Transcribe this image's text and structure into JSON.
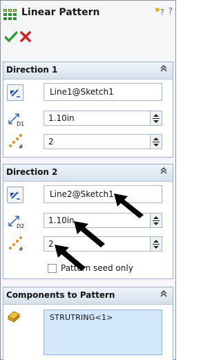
{
  "header": {
    "title": "Linear Pattern",
    "help_glyph": "?"
  },
  "actions": {
    "ok": "ok-check-icon",
    "cancel": "cancel-x-icon"
  },
  "direction1": {
    "title": "Direction 1",
    "direction_ref": "Line1@Sketch1",
    "spacing": "1.10in",
    "instances": "2"
  },
  "direction2": {
    "title": "Direction 2",
    "direction_ref": "Line2@Sketch1",
    "spacing": "1.10in",
    "instances": "2",
    "pattern_seed_only": "Pattern seed only"
  },
  "components": {
    "title": "Components to Pattern",
    "items": [
      "STRUTRING<1>"
    ]
  },
  "colors": {
    "group_border": "#9fb1c7",
    "header_gradient_top": "#eef3f9",
    "header_gradient_bottom": "#d7e1ed",
    "list_bg": "#d4e8fb",
    "ok_green": "#2e9e2e",
    "cancel_red": "#d42020"
  }
}
